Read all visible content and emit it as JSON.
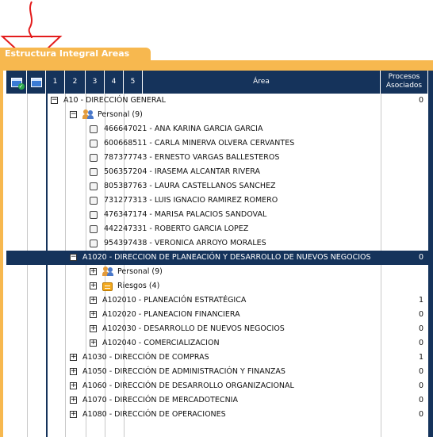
{
  "title": "Estructura Integral Areas",
  "header": {
    "cols": [
      "1",
      "2",
      "3",
      "4",
      "5"
    ],
    "area": "Área",
    "procesos": "Procesos Asociados"
  },
  "rows": [
    {
      "level": 1,
      "toggle": "−",
      "text": "A10 - DIRECCIÓN GENERAL",
      "count": "0"
    },
    {
      "level": 2,
      "toggle": "−",
      "icon": "people",
      "text": "Personal  (9)"
    },
    {
      "level": 3,
      "check": true,
      "text": "466647021 - ANA KARINA GARCIA GARCIA"
    },
    {
      "level": 3,
      "check": true,
      "text": "600668511 - CARLA MINERVA OLVERA CERVANTES"
    },
    {
      "level": 3,
      "check": true,
      "text": "787377743 - ERNESTO VARGAS BALLESTEROS"
    },
    {
      "level": 3,
      "check": true,
      "text": "506357204 - IRASEMA ALCANTAR RIVERA"
    },
    {
      "level": 3,
      "check": true,
      "text": "805387763 - LAURA CASTELLANOS SANCHEZ"
    },
    {
      "level": 3,
      "check": true,
      "text": "731277313 - LUIS IGNACIO RAMIREZ ROMERO"
    },
    {
      "level": 3,
      "check": true,
      "text": "476347174 - MARISA PALACIOS SANDOVAL"
    },
    {
      "level": 3,
      "check": true,
      "text": "442247331 - ROBERTO GARCIA LOPEZ"
    },
    {
      "level": 3,
      "check": true,
      "text": "954397438 - VERONICA ARROYO MORALES"
    },
    {
      "level": 2,
      "toggle": "−",
      "text": "A1020 - DIRECCION DE PLANEACIÓN Y DESARROLLO DE NUEVOS NEGOCIOS",
      "count": "0",
      "selected": true
    },
    {
      "level": 3,
      "toggle": "+",
      "icon": "people",
      "text": "Personal  (9)"
    },
    {
      "level": 3,
      "toggle": "+",
      "icon": "risk",
      "text": "Riesgos  (4)"
    },
    {
      "level": 3,
      "toggle": "+",
      "text": "A102010 - PLANEACIÓN ESTRATÉGICA",
      "count": "1"
    },
    {
      "level": 3,
      "toggle": "+",
      "text": "A102020 - PLANEACION FINANCIERA",
      "count": "0"
    },
    {
      "level": 3,
      "toggle": "+",
      "text": "A102030 - DESARROLLO DE NUEVOS NEGOCIOS",
      "count": "0"
    },
    {
      "level": 3,
      "toggle": "+",
      "text": "A102040 - COMERCIALIZACION",
      "count": "0"
    },
    {
      "level": 2,
      "toggle": "+",
      "text": "A1030 - DIRECCIÓN DE COMPRAS",
      "count": "1"
    },
    {
      "level": 2,
      "toggle": "+",
      "text": "A1050 - DIRECCIÓN DE ADMINISTRACIÓN Y FINANZAS",
      "count": "0"
    },
    {
      "level": 2,
      "toggle": "+",
      "text": "A1060 - DIRECCIÓN DE DESARROLLO ORGANIZACIONAL",
      "count": "0"
    },
    {
      "level": 2,
      "toggle": "+",
      "text": "A1070 - DIRECCIÓN DE MERCADOTECNIA",
      "count": "0"
    },
    {
      "level": 2,
      "toggle": "+",
      "text": "A1080 - DIRECCIÓN DE OPERACIONES",
      "count": "0"
    }
  ]
}
